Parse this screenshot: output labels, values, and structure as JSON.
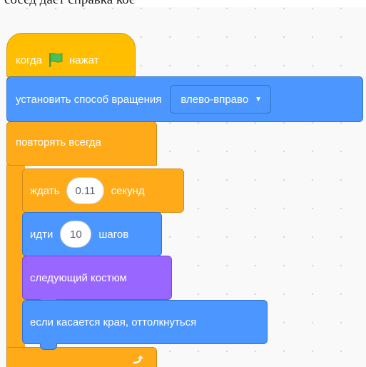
{
  "caption": {
    "text": "сосед дает справка кое"
  },
  "blocks": {
    "when_flag": {
      "label_before": "когда",
      "label_after": "нажат",
      "icon": "green-flag-icon"
    },
    "set_rotation": {
      "label": "установить способ вращения",
      "dropdown_value": "влево-вправо",
      "dropdown_icon": "chevron-down-icon"
    },
    "forever": {
      "label": "повторять всегда",
      "icon": "loop-arrow-icon"
    },
    "wait": {
      "label_before": "ждать",
      "value": "0.11",
      "label_after": "секунд"
    },
    "move": {
      "label_before": "идти",
      "value": "10",
      "label_after": "шагов"
    },
    "next_costume": {
      "label": "следующий костюм"
    },
    "bounce": {
      "label": "если касается края, оттолкнуться"
    }
  },
  "colors": {
    "events": "#ffbf00",
    "control": "#ffab19",
    "motion": "#4c97ff",
    "looks": "#9966ff",
    "flag": "#4cbf56",
    "workspace": "#f9f9f9"
  }
}
